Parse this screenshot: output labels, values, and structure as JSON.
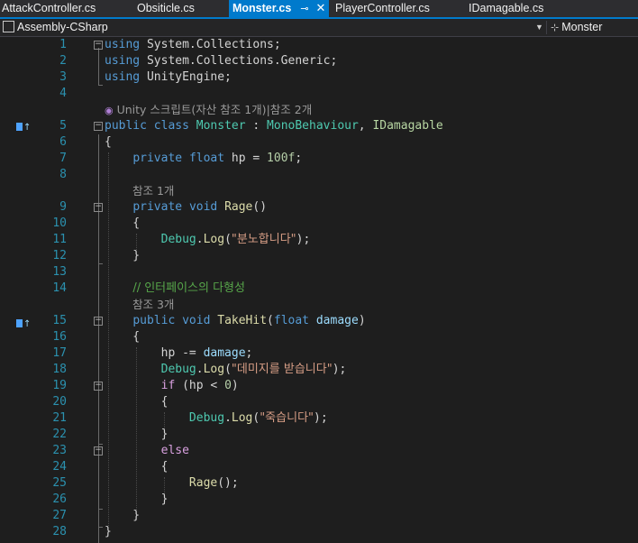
{
  "tabs": [
    {
      "label": "AttackController.cs"
    },
    {
      "label": "Obsiticle.cs"
    },
    {
      "label": "Monster.cs",
      "pin": "⊸",
      "close": "✕"
    },
    {
      "label": "PlayerController.cs"
    },
    {
      "label": "IDamagable.cs"
    }
  ],
  "navbar": {
    "project": "Assembly-CSharp",
    "class_icon": "class-icon",
    "class_name": "Monster"
  },
  "lens": {
    "unity_class": "Unity 스크립트(자산 참조 1개)|참조 2개",
    "rage_refs": "참조 1개",
    "takehit_refs": "참조 3개"
  },
  "lines": [
    {
      "n": "1",
      "tokens": [
        [
          "kw",
          "using"
        ],
        [
          "ns",
          " System.Collections;"
        ]
      ]
    },
    {
      "n": "2",
      "tokens": [
        [
          "kw",
          "using"
        ],
        [
          "ns",
          " System.Collections.Generic;"
        ]
      ]
    },
    {
      "n": "3",
      "tokens": [
        [
          "kw",
          "using"
        ],
        [
          "ns",
          " UnityEngine;"
        ]
      ]
    },
    {
      "n": "4",
      "tokens": []
    },
    {
      "n": "5",
      "tokens": [
        [
          "kw",
          "public"
        ],
        [
          "ns",
          " "
        ],
        [
          "kw",
          "class"
        ],
        [
          "ns",
          " "
        ],
        [
          "type",
          "Monster"
        ],
        [
          "ns",
          " : "
        ],
        [
          "type",
          "MonoBehaviour"
        ],
        [
          "ns",
          ", "
        ],
        [
          "iface",
          "IDamagable"
        ]
      ]
    },
    {
      "n": "6",
      "tokens": [
        [
          "ns",
          "{"
        ]
      ]
    },
    {
      "n": "7",
      "tokens": [
        [
          "ns",
          "    "
        ],
        [
          "kw",
          "private"
        ],
        [
          "ns",
          " "
        ],
        [
          "kw",
          "float"
        ],
        [
          "ns",
          " hp = "
        ],
        [
          "num",
          "100f"
        ],
        [
          "ns",
          ";"
        ]
      ]
    },
    {
      "n": "8",
      "tokens": []
    },
    {
      "n": "9",
      "tokens": [
        [
          "ns",
          "    "
        ],
        [
          "kw",
          "private"
        ],
        [
          "ns",
          " "
        ],
        [
          "kw",
          "void"
        ],
        [
          "ns",
          " "
        ],
        [
          "method",
          "Rage"
        ],
        [
          "ns",
          "()"
        ]
      ]
    },
    {
      "n": "10",
      "tokens": [
        [
          "ns",
          "    {"
        ]
      ]
    },
    {
      "n": "11",
      "tokens": [
        [
          "ns",
          "        "
        ],
        [
          "type",
          "Debug"
        ],
        [
          "ns",
          "."
        ],
        [
          "method",
          "Log"
        ],
        [
          "ns",
          "("
        ],
        [
          "str",
          "\"분노합니다\""
        ],
        [
          "ns",
          ");"
        ]
      ]
    },
    {
      "n": "12",
      "tokens": [
        [
          "ns",
          "    }"
        ]
      ]
    },
    {
      "n": "13",
      "tokens": []
    },
    {
      "n": "14",
      "tokens": [
        [
          "ns",
          "    "
        ],
        [
          "cmt",
          "// 인터페이스의 다형성"
        ]
      ]
    },
    {
      "n": "15",
      "tokens": [
        [
          "ns",
          "    "
        ],
        [
          "kw",
          "public"
        ],
        [
          "ns",
          " "
        ],
        [
          "kw",
          "void"
        ],
        [
          "ns",
          " "
        ],
        [
          "method",
          "TakeHit"
        ],
        [
          "ns",
          "("
        ],
        [
          "kw",
          "float"
        ],
        [
          "ns",
          " "
        ],
        [
          "param",
          "damage"
        ],
        [
          "ns",
          ")"
        ]
      ]
    },
    {
      "n": "16",
      "tokens": [
        [
          "ns",
          "    {"
        ]
      ]
    },
    {
      "n": "17",
      "tokens": [
        [
          "ns",
          "        hp -= "
        ],
        [
          "param",
          "damage"
        ],
        [
          "ns",
          ";"
        ]
      ]
    },
    {
      "n": "18",
      "tokens": [
        [
          "ns",
          "        "
        ],
        [
          "type",
          "Debug"
        ],
        [
          "ns",
          "."
        ],
        [
          "method",
          "Log"
        ],
        [
          "ns",
          "("
        ],
        [
          "str",
          "\"데미지를 받습니다\""
        ],
        [
          "ns",
          ");"
        ]
      ]
    },
    {
      "n": "19",
      "tokens": [
        [
          "ns",
          "        "
        ],
        [
          "ctl",
          "if"
        ],
        [
          "ns",
          " (hp < "
        ],
        [
          "num",
          "0"
        ],
        [
          "ns",
          ")"
        ]
      ]
    },
    {
      "n": "20",
      "tokens": [
        [
          "ns",
          "        {"
        ]
      ]
    },
    {
      "n": "21",
      "tokens": [
        [
          "ns",
          "            "
        ],
        [
          "type",
          "Debug"
        ],
        [
          "ns",
          "."
        ],
        [
          "method",
          "Log"
        ],
        [
          "ns",
          "("
        ],
        [
          "str",
          "\"죽습니다\""
        ],
        [
          "ns",
          ");"
        ]
      ]
    },
    {
      "n": "22",
      "tokens": [
        [
          "ns",
          "        }"
        ]
      ]
    },
    {
      "n": "23",
      "tokens": [
        [
          "ns",
          "        "
        ],
        [
          "ctl",
          "else"
        ]
      ]
    },
    {
      "n": "24",
      "tokens": [
        [
          "ns",
          "        {"
        ]
      ]
    },
    {
      "n": "25",
      "tokens": [
        [
          "ns",
          "            "
        ],
        [
          "method",
          "Rage"
        ],
        [
          "ns",
          "();"
        ]
      ]
    },
    {
      "n": "26",
      "tokens": [
        [
          "ns",
          "        }"
        ]
      ]
    },
    {
      "n": "27",
      "tokens": [
        [
          "ns",
          "    }"
        ]
      ]
    },
    {
      "n": "28",
      "tokens": [
        [
          "ns",
          "}"
        ]
      ]
    }
  ]
}
